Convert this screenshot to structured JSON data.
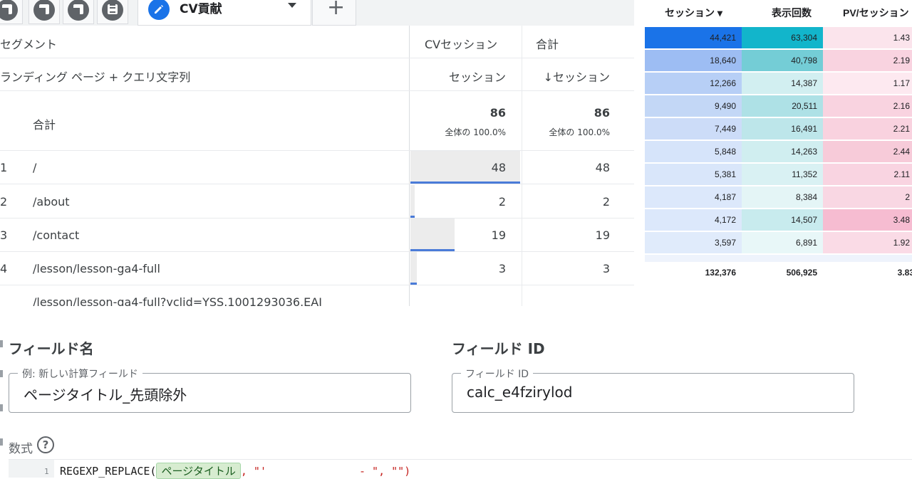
{
  "tabs": {
    "active_label": "CV貢献",
    "add_label": "+"
  },
  "table": {
    "dimension_header": "セグメント",
    "dimension_sub": "ランディング ページ + クエリ文字列",
    "columns": [
      {
        "segment": "CVセッション",
        "metric": "セッション"
      },
      {
        "segment": "合計",
        "metric": "↓セッション"
      }
    ],
    "total": {
      "label": "合計",
      "values": [
        "86",
        "86"
      ],
      "share": [
        "全体の 100.0%",
        "全体の 100.0%"
      ]
    },
    "rows": [
      {
        "index": "1",
        "page": "/",
        "cv": "48",
        "total": "48",
        "bar": 1.0
      },
      {
        "index": "2",
        "page": "/about",
        "cv": "2",
        "total": "2",
        "bar": 0.04
      },
      {
        "index": "3",
        "page": "/contact",
        "cv": "19",
        "total": "19",
        "bar": 0.4
      },
      {
        "index": "4",
        "page": "/lesson/lesson-ga4-full",
        "cv": "3",
        "total": "3",
        "bar": 0.06
      },
      {
        "index": "",
        "page": "/lesson/lesson-ga4-full?yclid=YSS.1001293036.EAI",
        "cv": "",
        "total": "",
        "bar": 0
      }
    ]
  },
  "looker": {
    "headers": [
      "セッション ▾",
      "表示回数",
      "PV/セッション"
    ],
    "rows": [
      [
        "44,421",
        "63,304",
        "1.43"
      ],
      [
        "18,640",
        "40,798",
        "2.19"
      ],
      [
        "12,266",
        "14,387",
        "1.17"
      ],
      [
        "9,490",
        "20,511",
        "2.16"
      ],
      [
        "7,449",
        "16,491",
        "2.21"
      ],
      [
        "5,848",
        "14,263",
        "2.44"
      ],
      [
        "5,381",
        "11,352",
        "2.11"
      ],
      [
        "4,187",
        "8,384",
        "2"
      ],
      [
        "4,172",
        "14,507",
        "3.48"
      ],
      [
        "3,597",
        "6,891",
        "1.92"
      ]
    ],
    "totals": [
      "132,376",
      "506,925",
      "3.83"
    ],
    "colors": {
      "col1": [
        "#1a73e8",
        "#9dbdf3",
        "#b7cff6",
        "#c3d7f6",
        "#ccdcf8",
        "#d6e4fa",
        "#d9e6fa",
        "#dce8fb",
        "#dce8fb",
        "#e0ebfb"
      ],
      "col2": [
        "#12b5cb",
        "#74cdd6",
        "#d2eff1",
        "#aee1e6",
        "#bde6ea",
        "#d0eef0",
        "#d9f1f3",
        "#e4f5f6",
        "#c8ebee",
        "#e8f7f8"
      ],
      "col3": [
        "#fbe4ec",
        "#f9d3e0",
        "#fde9f0",
        "#f9d3e0",
        "#f9d2df",
        "#f7cbd9",
        "#f9d4e1",
        "#f9d7e3",
        "#f6bcd1",
        "#fadbe6"
      ]
    }
  },
  "calc": {
    "field_name_title": "フィールド名",
    "field_name_label": "例: 新しい計算フィールド",
    "field_name_value": "ページタイトル_先頭除外",
    "field_id_title": "フィールド ID",
    "field_id_label": "フィールド ID",
    "field_id_value": "calc_e4fzirylod",
    "formula_label": "数式",
    "help_icon": "?",
    "line_number": "1",
    "code_prefix": "REGEXP_REPLACE(",
    "code_chip": "ページタイトル",
    "code_rest": ", \"'",
    "code_mid": "- \", \"\")"
  }
}
